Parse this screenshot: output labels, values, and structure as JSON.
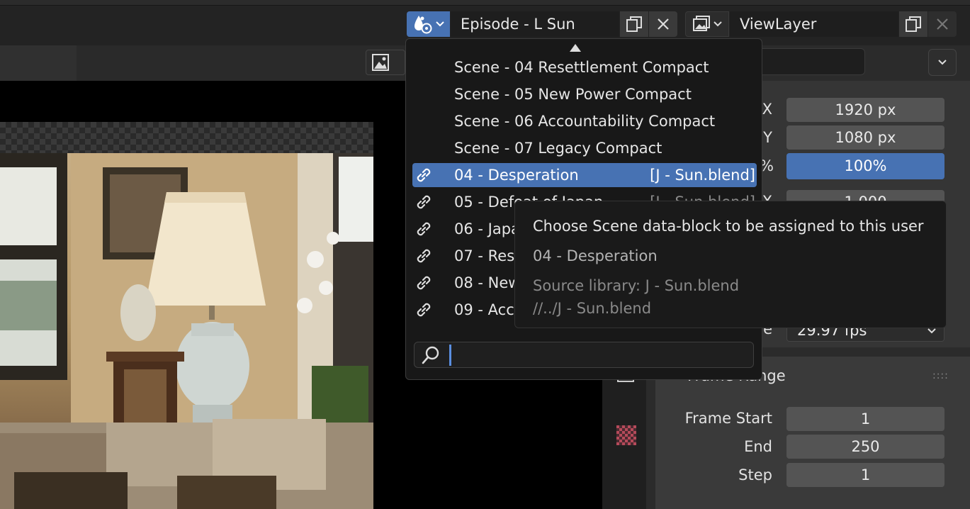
{
  "header": {
    "scene_field_value": "Episode - L Sun",
    "viewlayer_field_value": "ViewLayer"
  },
  "dropdown": {
    "items": [
      {
        "label": "Scene - 04 Resettlement Compact",
        "library": "",
        "linked": false,
        "selected": false
      },
      {
        "label": "Scene - 05 New Power Compact",
        "library": "",
        "linked": false,
        "selected": false
      },
      {
        "label": "Scene - 06 Accountability Compact",
        "library": "",
        "linked": false,
        "selected": false
      },
      {
        "label": "Scene - 07 Legacy Compact",
        "library": "",
        "linked": false,
        "selected": false
      },
      {
        "label": "04 - Desperation",
        "library": "[J - Sun.blend]",
        "linked": true,
        "selected": true
      },
      {
        "label": "05 - Defeat of Japan",
        "library": "[J - Sun.blend]",
        "linked": true,
        "selected": false
      },
      {
        "label": "06 - Japa",
        "library": "",
        "linked": true,
        "selected": false
      },
      {
        "label": "07 - Res",
        "library": "",
        "linked": true,
        "selected": false
      },
      {
        "label": "08 - New",
        "library": "",
        "linked": true,
        "selected": false
      },
      {
        "label": "09 - Acc",
        "library": "",
        "linked": true,
        "selected": false
      }
    ],
    "search_value": ""
  },
  "tooltip": {
    "title": "Choose Scene data-block to be assigned to this user",
    "value": "04 - Desperation",
    "source": "Source library: J - Sun.blend",
    "path": "//../J - Sun.blend"
  },
  "properties": {
    "resolution_x_label": "X",
    "resolution_x": "1920 px",
    "resolution_y_label": "Y",
    "resolution_y": "1080 px",
    "percent_label": "%",
    "percent": "100%",
    "aspect_x_label": "X",
    "aspect_x": "1.000",
    "frame_rate_label": "e",
    "frame_rate": "29.97 fps",
    "frame_range_title": "Frame Range",
    "frame_start_label": "Frame Start",
    "frame_start": "1",
    "end_label": "End",
    "end": "250",
    "step_label": "Step",
    "step": "1"
  },
  "colors": {
    "accent": "#4772b3",
    "panel": "#353535",
    "field": "#545454"
  }
}
